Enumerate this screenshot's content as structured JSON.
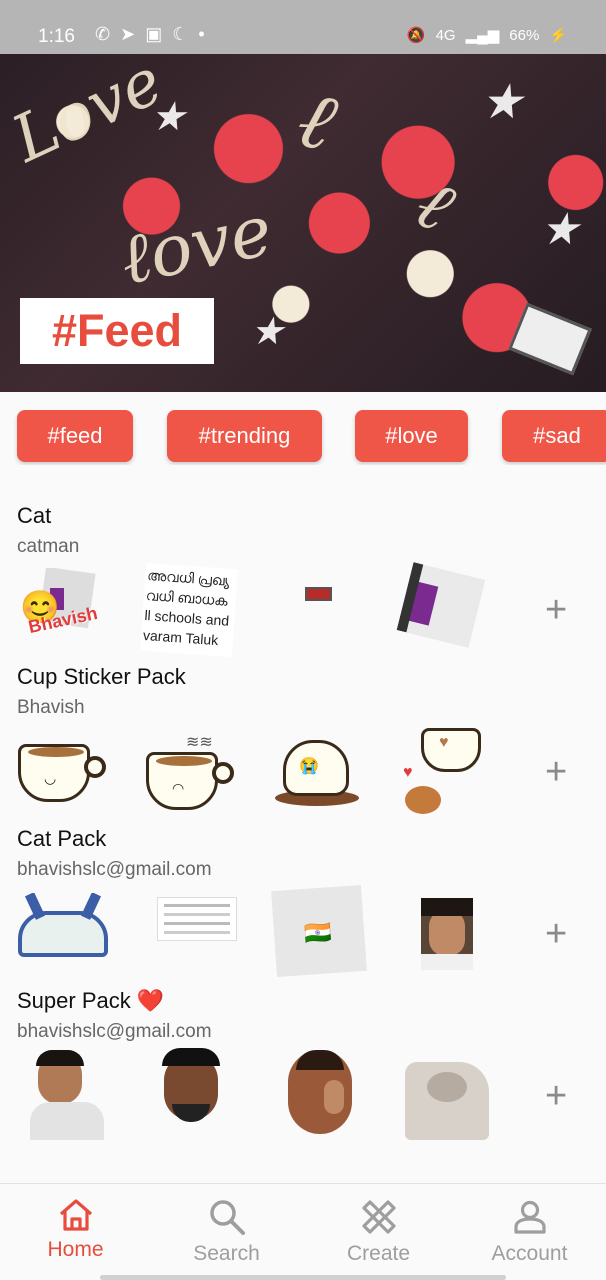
{
  "status_bar": {
    "time": "1:16",
    "battery": "66%",
    "signal": "4G"
  },
  "hero": {
    "tag_text": "#Feed"
  },
  "chips": [
    "#feed",
    "#trending",
    "#love",
    "#sad"
  ],
  "packs": [
    {
      "title": "Cat",
      "author": "catman",
      "sticker_texts": [
        "Bhavish",
        "അവധി പ്രഖ്യ\nവധി ബാധക\nll schools and\nvaram Taluk"
      ]
    },
    {
      "title": "Cup Sticker Pack",
      "author": "Bhavish"
    },
    {
      "title": "Cat Pack",
      "author": "bhavishslc@gmail.com"
    },
    {
      "title": "Super Pack ❤️",
      "author": "bhavishslc@gmail.com"
    }
  ],
  "nav": {
    "home": "Home",
    "search": "Search",
    "create": "Create",
    "account": "Account"
  },
  "colors": {
    "accent": "#ef5647",
    "status_bar": "#b5b5b5"
  },
  "icons": [
    "home-icon",
    "search-icon",
    "create-icon",
    "account-icon",
    "plus-icon"
  ]
}
